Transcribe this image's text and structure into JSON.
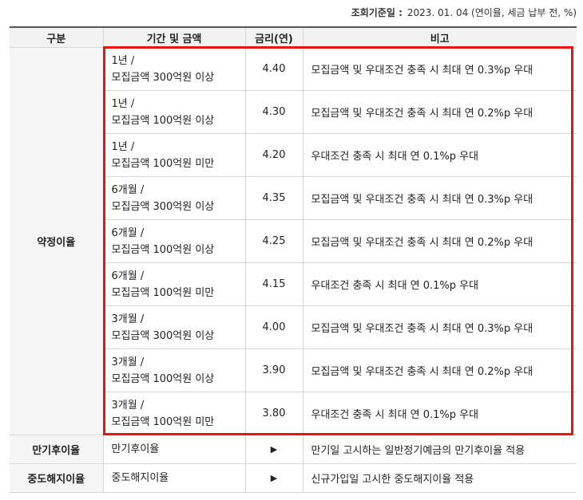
{
  "reference": {
    "label": "조회기준일 :",
    "value": "2023. 01. 04 (연이율, 세금 납부 전, %)"
  },
  "headers": [
    "구분",
    "기간 및 금액",
    "금리(연)",
    "비고"
  ],
  "agreed_label": "약정이율",
  "agreed_rows": [
    {
      "period": "1년 /",
      "amount": "모집금액 300억원 이상",
      "rate": "4.40",
      "note": "모집금액 및 우대조건 충족 시 최대 연 0.3%p 우대"
    },
    {
      "period": "1년 /",
      "amount": "모집금액 100억원 이상",
      "rate": "4.30",
      "note": "모집금액 및 우대조건 충족 시 최대 연 0.2%p 우대"
    },
    {
      "period": "1년 /",
      "amount": "모집금액 100억원 미만",
      "rate": "4.20",
      "note": "우대조건 충족 시 최대 연 0.1%p 우대"
    },
    {
      "period": "6개월 /",
      "amount": "모집금액 300억원 이상",
      "rate": "4.35",
      "note": "모집금액 및 우대조건 충족 시 최대 연 0.3%p 우대"
    },
    {
      "period": "6개월 /",
      "amount": "모집금액 100억원 이상",
      "rate": "4.25",
      "note": "모집금액 및 우대조건 충족 시 최대 연 0.2%p 우대"
    },
    {
      "period": "6개월 /",
      "amount": "모집금액 100억원 미만",
      "rate": "4.15",
      "note": "우대조건 충족 시 최대 연 0.1%p 우대"
    },
    {
      "period": "3개월 /",
      "amount": "모집금액 300억원 이상",
      "rate": "4.00",
      "note": "모집금액 및 우대조건 충족 시 최대 연 0.3%p 우대"
    },
    {
      "period": "3개월 /",
      "amount": "모집금액 100억원 이상",
      "rate": "3.90",
      "note": "모집금액 및 우대조건 충족 시 최대 연 0.2%p 우대"
    },
    {
      "period": "3개월 /",
      "amount": "모집금액 100억원 미만",
      "rate": "3.80",
      "note": "우대조건 충족 시 최대 연 0.1%p 우대"
    }
  ],
  "other_rows": [
    {
      "category": "만기후이율",
      "term": "만기후이율",
      "rate": "▶",
      "note": "만기일 고시하는 일반정기예금의 만기후이율 적용"
    },
    {
      "category": "중도해지이율",
      "term": "중도해지이율",
      "rate": "▶",
      "note": "신규가입일 고시한 중도해지이율 적용"
    }
  ],
  "highlight_color": "#ee1111"
}
